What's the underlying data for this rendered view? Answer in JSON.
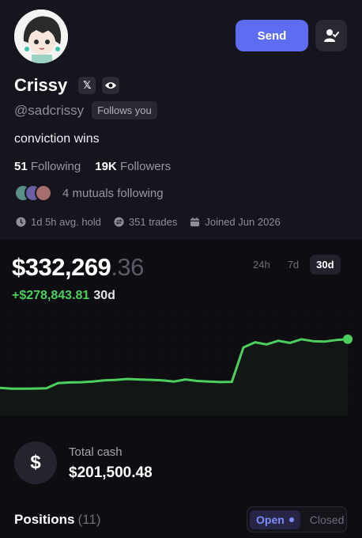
{
  "header": {
    "send_label": "Send"
  },
  "profile": {
    "name": "Crissy",
    "handle": "@sadcrissy",
    "follows_you": "Follows you",
    "bio": "conviction wins",
    "following_count": "51",
    "following_label": "Following",
    "followers_count": "19K",
    "followers_label": "Followers",
    "mutuals_text": "4 mutuals following",
    "avg_hold": "1d 5h avg. hold",
    "trades": "351 trades",
    "joined": "Joined Jun 2026",
    "x_badge": "𝕏"
  },
  "portfolio": {
    "balance_main": "$332,269",
    "balance_cents": ".36",
    "change_value": "+$278,843.81",
    "change_period": "30d",
    "ranges": [
      "24h",
      "7d",
      "30d"
    ],
    "active_range": "30d",
    "accent_color": "#4ccf5f"
  },
  "cash": {
    "icon": "$",
    "label": "Total cash",
    "value": "$201,500.48"
  },
  "positions": {
    "label": "Positions",
    "count": "(11)",
    "toggle_open": "Open",
    "toggle_closed": "Closed"
  },
  "chart_data": {
    "type": "line",
    "title": "",
    "xlabel": "",
    "ylabel": "",
    "x": [
      0,
      1,
      2,
      3,
      4,
      5,
      6,
      7,
      8,
      9,
      10,
      11,
      12,
      13,
      14,
      15,
      16,
      17,
      18,
      19,
      20,
      21,
      22,
      23,
      24,
      25,
      26,
      27,
      28,
      29,
      30
    ],
    "values": [
      54000,
      50000,
      50000,
      51000,
      52000,
      76000,
      79000,
      80000,
      83000,
      89000,
      91000,
      95000,
      93000,
      91000,
      89000,
      83000,
      93000,
      86000,
      83000,
      81000,
      82000,
      241000,
      265000,
      255000,
      272000,
      262000,
      278844,
      270000,
      268000,
      275000,
      278844
    ],
    "ylim": [
      0,
      300000
    ],
    "grid": false,
    "color": "#4ccf5f"
  }
}
